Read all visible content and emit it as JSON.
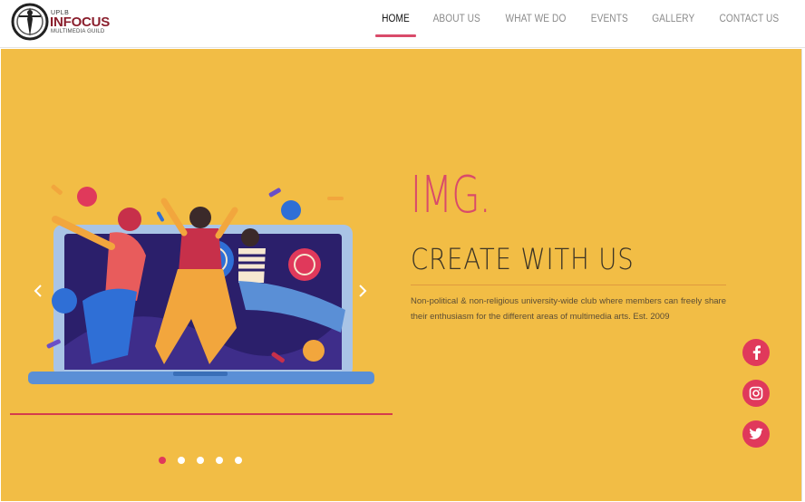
{
  "logo": {
    "small": "UPLB",
    "name": "INFOCUS",
    "sub": "MULTIMEDIA GUILD"
  },
  "nav": {
    "items": [
      "HOME",
      "ABOUT US",
      "WHAT WE DO",
      "EVENTS",
      "GALLERY",
      "CONTACT US"
    ],
    "active": "HOME"
  },
  "hero": {
    "title": "IMG.",
    "subtitle": "CREATE WITH US",
    "description": "Non-political & non-religious university-wide club where members can freely share their enthusiasm for the different areas of multimedia arts. Est. 2009"
  },
  "carousel": {
    "slide_count": 5,
    "active_index": 0,
    "prev_icon": "chevron-left-icon",
    "next_icon": "chevron-right-icon"
  },
  "social": {
    "icons": [
      "facebook-icon",
      "instagram-icon",
      "twitter-icon"
    ]
  },
  "colors": {
    "accent": "#e0395b",
    "hero_bg": "#f2bd45",
    "logo_text": "#8a1f2d",
    "nav_text": "#8a8a8a",
    "nav_active": "#111111"
  }
}
